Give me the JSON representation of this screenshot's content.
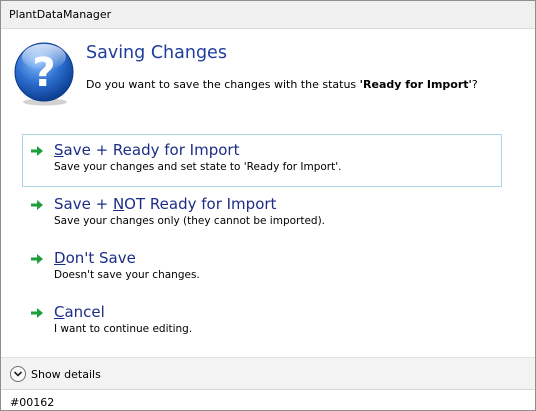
{
  "window": {
    "title": "PlantDataManager"
  },
  "dialog": {
    "heading": "Saving Changes",
    "message_prefix": "Do you want to save the changes with the status ",
    "message_status": "'Ready for Import'",
    "message_suffix": "?"
  },
  "options": [
    {
      "title_accel": "S",
      "title_rest": "ave + Ready for Import",
      "description": "Save your changes and set state to 'Ready for Import'.",
      "selected": true
    },
    {
      "title_pre": "Save + ",
      "title_accel": "N",
      "title_rest": "OT Ready for Import",
      "description": "Save your changes only (they cannot be imported).",
      "selected": false
    },
    {
      "title_accel": "D",
      "title_rest": "on't Save",
      "description": "Doesn't save your changes.",
      "selected": false
    },
    {
      "title_accel": "C",
      "title_rest": "ancel",
      "description": "I want to continue editing.",
      "selected": false
    }
  ],
  "footer": {
    "toggle_label": "Show details",
    "status_text": "#00162"
  },
  "colors": {
    "heading": "#1e3d9e",
    "option_title": "#1c2d87",
    "arrow": "#1f9f3a",
    "selected_border": "#a9d4e2",
    "icon_blue": "#2d6fcf"
  }
}
